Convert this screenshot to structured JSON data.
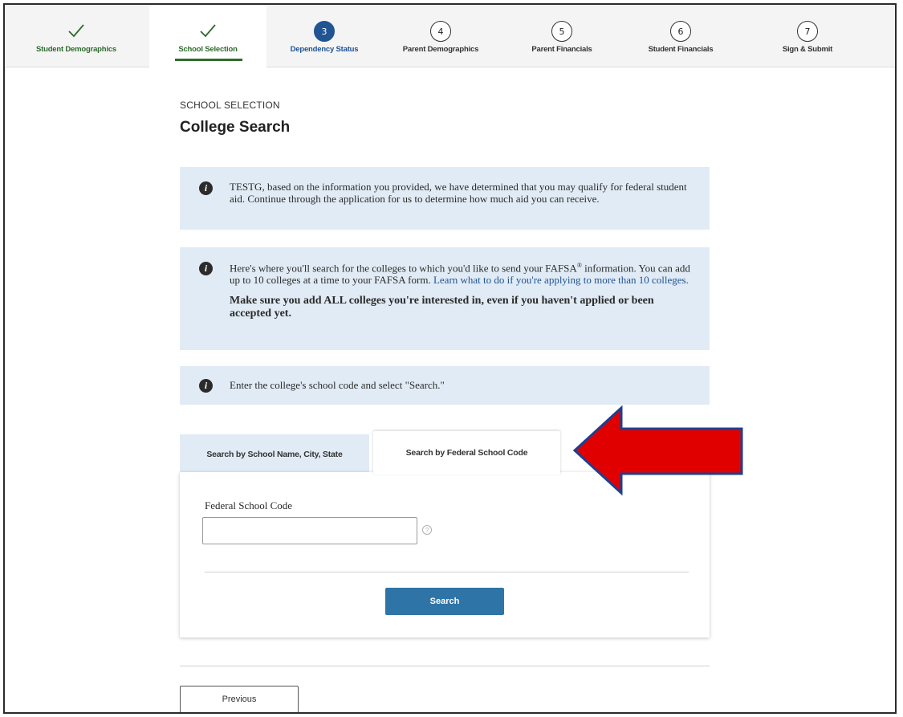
{
  "stepper": {
    "steps": [
      {
        "number": "",
        "label": "Student Demographics",
        "state": "completed"
      },
      {
        "number": "",
        "label": "School Selection",
        "state": "completed-active"
      },
      {
        "number": "3",
        "label": "Dependency Status",
        "state": "current"
      },
      {
        "number": "4",
        "label": "Parent Demographics",
        "state": "upcoming"
      },
      {
        "number": "5",
        "label": "Parent Financials",
        "state": "upcoming"
      },
      {
        "number": "6",
        "label": "Student Financials",
        "state": "upcoming"
      },
      {
        "number": "7",
        "label": "Sign & Submit",
        "state": "upcoming"
      }
    ]
  },
  "page": {
    "eyebrow": "SCHOOL SELECTION",
    "title": "College Search"
  },
  "alerts": {
    "eligibility": {
      "text": "TESTG, based on the information you provided, we have determined that you may qualify for federal student aid. Continue through the application for us to determine how much aid you can receive."
    },
    "instructions": {
      "text_before_sup": "Here's where you'll search for the colleges to which you'd like to send your FAFSA",
      "sup": "®",
      "text_after_sup": " information. You can add up to 10 colleges at a time to your FAFSA form. ",
      "link": "Learn what to do if you're applying to more than 10 colleges.",
      "emphasis": "Make sure you add ALL colleges you're interested in, even if you haven't applied or been accepted yet."
    },
    "code_hint": {
      "text": "Enter the college's school code and select \"Search.\""
    }
  },
  "tabs": {
    "by_name": "Search by School Name, City, State",
    "by_code": "Search by Federal School Code",
    "selected": "by_code"
  },
  "form": {
    "field_label": "Federal School Code",
    "field_value": "",
    "help_glyph": "?",
    "search_label": "Search"
  },
  "footer": {
    "previous_label": "Previous"
  },
  "colors": {
    "primary_blue": "#2f74a6",
    "alert_bg": "#e1ebf5",
    "completed_green": "#2e6b2e",
    "current_step": "#205493",
    "annotation_red": "#e10000",
    "annotation_outline": "#1f3f8f"
  }
}
